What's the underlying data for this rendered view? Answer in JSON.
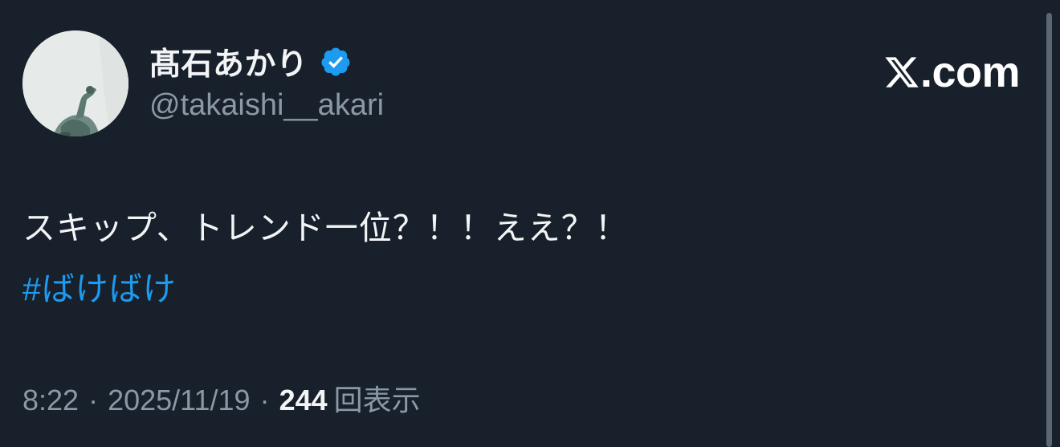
{
  "user": {
    "display_name": "髙石あかり",
    "handle": "@takaishi__akari",
    "verified": true,
    "verified_color": "#1d9bf0"
  },
  "brand": {
    "logo_text": ".com",
    "logo_icon": "x-logo-icon"
  },
  "tweet": {
    "text": "スキップ、トレンド一位？！！ええ？！",
    "hashtag": "#ばけばけ"
  },
  "meta": {
    "time": "8:22",
    "separator": "·",
    "date": "2025/11/19",
    "views_count": "244",
    "views_label": "回表示"
  },
  "colors": {
    "background": "#17202b",
    "text_primary": "#f3f4f5",
    "text_secondary": "#8b98a5",
    "link": "#1d9bf0"
  }
}
